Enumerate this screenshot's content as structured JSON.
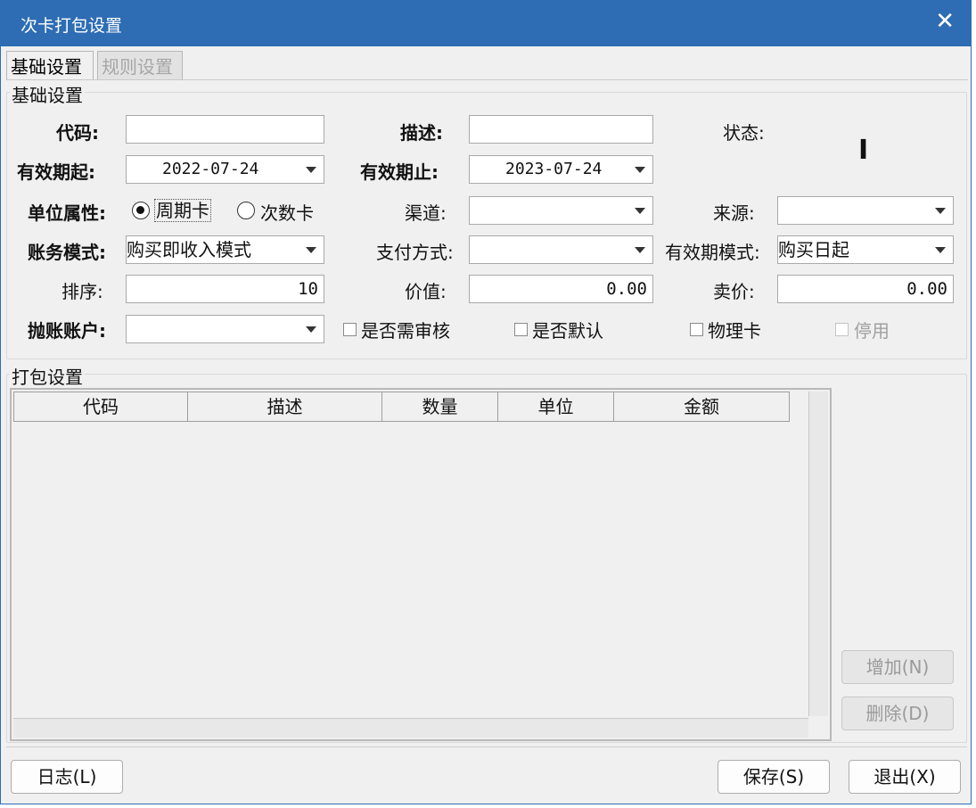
{
  "window": {
    "title": "次卡打包设置"
  },
  "tabs": [
    {
      "label": "基础设置",
      "active": true
    },
    {
      "label": "规则设置",
      "active": false
    }
  ],
  "basic": {
    "group_label": "基础设置",
    "code": {
      "label": "代码:",
      "value": ""
    },
    "desc": {
      "label": "描述:",
      "value": ""
    },
    "status": {
      "label": "状态:",
      "value": "I"
    },
    "valid_from": {
      "label": "有效期起:",
      "value": "2022-07-24"
    },
    "valid_to": {
      "label": "有效期止:",
      "value": "2023-07-24"
    },
    "unit_attr": {
      "label": "单位属性:",
      "options": [
        "周期卡",
        "次数卡"
      ],
      "selected": "周期卡"
    },
    "channel": {
      "label": "渠道:",
      "value": ""
    },
    "source": {
      "label": "来源:",
      "value": ""
    },
    "account_mode": {
      "label": "账务模式:",
      "value": "购买即收入模式"
    },
    "pay_method": {
      "label": "支付方式:",
      "value": ""
    },
    "valid_mode": {
      "label": "有效期模式:",
      "value": "购买日起"
    },
    "sort": {
      "label": "排序:",
      "value": "10"
    },
    "worth": {
      "label": "价值:",
      "value": "0.00"
    },
    "price": {
      "label": "卖价:",
      "value": "0.00"
    },
    "throw_account": {
      "label": "抛账账户:",
      "value": ""
    },
    "checkboxes": {
      "need_audit": "是否需审核",
      "is_default": "是否默认",
      "physical": "物理卡",
      "disabled": "停用"
    }
  },
  "package": {
    "group_label": "打包设置",
    "columns": [
      "代码",
      "描述",
      "数量",
      "单位",
      "金额"
    ],
    "rows": []
  },
  "buttons": {
    "add": "增加(N)",
    "delete": "删除(D)",
    "log": "日志(L)",
    "save": "保存(S)",
    "exit": "退出(X)"
  }
}
